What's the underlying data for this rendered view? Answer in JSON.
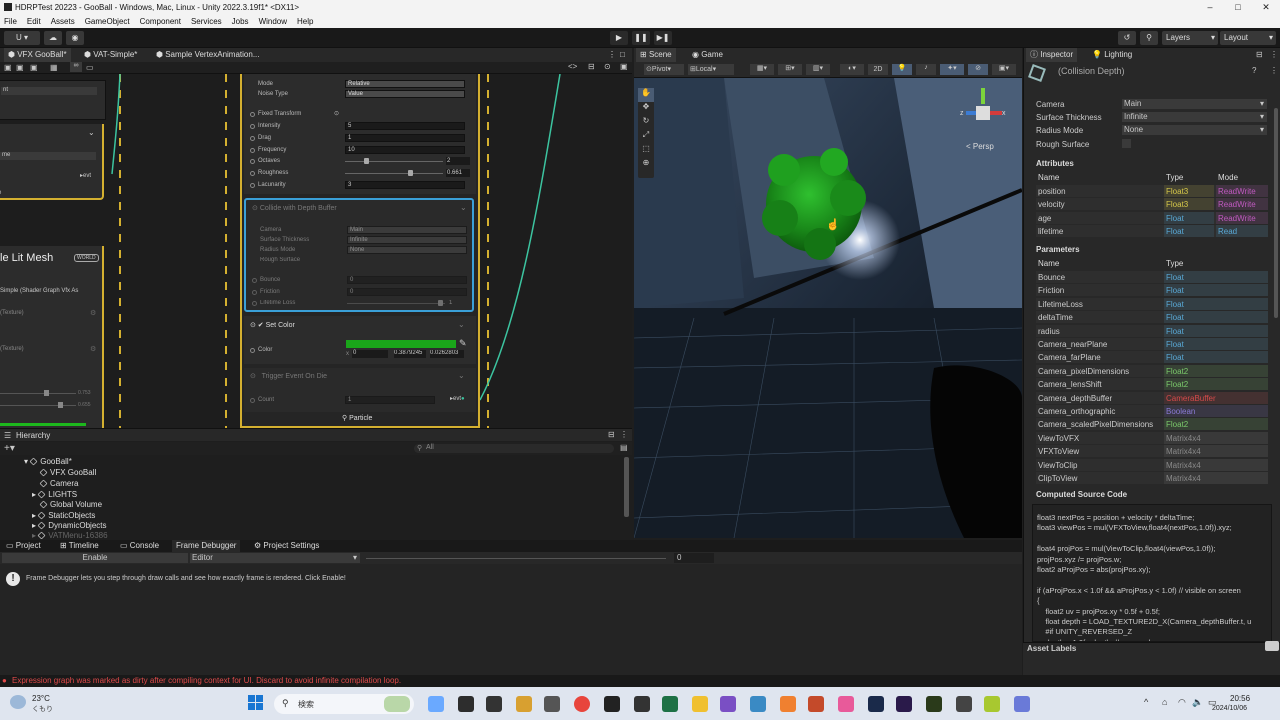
{
  "window": {
    "title": "HDRPTest 20223 - GooBall - Windows, Mac, Linux - Unity 2022.3.19f1* <DX11>"
  },
  "menu": [
    "File",
    "Edit",
    "Assets",
    "GameObject",
    "Component",
    "Services",
    "Jobs",
    "Window",
    "Help"
  ],
  "toolbar": {
    "account": "U",
    "layers": "Layers",
    "layout": "Layout"
  },
  "vfx": {
    "tabs": [
      "VFX GooBall*",
      "VAT-Simple*",
      "Sample VertexAnimation..."
    ],
    "left_node_title": "le Lit Mesh",
    "left_node_badge": "WORLD",
    "left_node_sub": "Simple (Shader Graph Vfx As",
    "left_texture1": "(Texture)",
    "left_texture2": "(Texture)",
    "left_evt": "evt",
    "left_val1": "0.753",
    "left_val2": "0.655",
    "left_sel": "nt",
    "left_sel2": "me",
    "left_e": "e",
    "noise": {
      "mode_label": "Mode",
      "mode_value": "Relative",
      "noise_type_label": "Noise Type",
      "noise_type_value": "Value",
      "fixed_transform": "Fixed Transform",
      "intensity_label": "Intensity",
      "intensity_value": "5",
      "drag_label": "Drag",
      "drag_value": "1",
      "frequency_label": "Frequency",
      "frequency_value": "10",
      "octaves_label": "Octaves",
      "octaves_value": "2",
      "roughness_label": "Roughness",
      "roughness_value": "0.661",
      "lacunarity_label": "Lacunarity",
      "lacunarity_value": "3"
    },
    "collide": {
      "title": "Collide with Depth Buffer",
      "camera_label": "Camera",
      "camera_value": "Main",
      "surface_label": "Surface Thickness",
      "surface_value": "Infinite",
      "radius_label": "Radius Mode",
      "radius_value": "None",
      "rough_label": "Rough Surface",
      "bounce_label": "Bounce",
      "bounce_value": "0",
      "friction_label": "Friction",
      "friction_value": "0",
      "lifetime_label": "Lifetime Loss",
      "lifetime_value": "1"
    },
    "setcolor": {
      "title": "Set Color",
      "color_label": "Color",
      "x_label": "x",
      "x_value": "0",
      "y_value": "0.3879245",
      "z_value": "0.0262803",
      "color": "#1aa61a"
    },
    "trigger": {
      "title": "Trigger Event On Die",
      "count_label": "Count",
      "count_value": "1",
      "evt": "evt",
      "particle": "Particle"
    }
  },
  "hierarchy": {
    "title": "Hierarchy",
    "search_placeholder": "All",
    "items": [
      "GooBall*",
      "VFX GooBall",
      "Camera",
      "LIGHTS",
      "Global Volume",
      "StaticObjects",
      "DynamicObjects",
      "VATMenu-16386"
    ]
  },
  "bottom_tabs": [
    "Project",
    "Timeline",
    "Console",
    "Frame Debugger",
    "Project Settings"
  ],
  "frame_debugger": {
    "enable": "Enable",
    "editor": "Editor",
    "slider_value": "0",
    "info": "Frame Debugger lets you step through draw calls and see how exactly frame is rendered. Click Enable!"
  },
  "scene": {
    "tabs": [
      "Scene",
      "Game"
    ],
    "pivot": "Pivot",
    "local": "Local",
    "mode2d": "2D",
    "persp": "< Persp",
    "axis_z": "z",
    "axis_x": "x"
  },
  "inspector": {
    "tabs": [
      "Inspector",
      "Lighting"
    ],
    "header": "(Collision Depth)",
    "camera_label": "Camera",
    "camera_value": "Main",
    "surface_label": "Surface Thickness",
    "surface_value": "Infinite",
    "radius_label": "Radius Mode",
    "radius_value": "None",
    "rough_label": "Rough Surface",
    "attributes_title": "Attributes",
    "attr_headers": [
      "Name",
      "Type",
      "Mode"
    ],
    "attributes": [
      {
        "name": "position",
        "type": "Float3",
        "mode": "ReadWrite"
      },
      {
        "name": "velocity",
        "type": "Float3",
        "mode": "ReadWrite"
      },
      {
        "name": "age",
        "type": "Float",
        "mode": "ReadWrite"
      },
      {
        "name": "lifetime",
        "type": "Float",
        "mode": "Read"
      }
    ],
    "parameters_title": "Parameters",
    "param_headers": [
      "Name",
      "Type"
    ],
    "parameters": [
      {
        "name": "Bounce",
        "type": "Float"
      },
      {
        "name": "Friction",
        "type": "Float"
      },
      {
        "name": "LifetimeLoss",
        "type": "Float"
      },
      {
        "name": "deltaTime",
        "type": "Float"
      },
      {
        "name": "radius",
        "type": "Float"
      },
      {
        "name": "Camera_nearPlane",
        "type": "Float"
      },
      {
        "name": "Camera_farPlane",
        "type": "Float"
      },
      {
        "name": "Camera_pixelDimensions",
        "type": "Float2"
      },
      {
        "name": "Camera_lensShift",
        "type": "Float2"
      },
      {
        "name": "Camera_depthBuffer",
        "type": "CameraBuffer"
      },
      {
        "name": "Camera_orthographic",
        "type": "Boolean"
      },
      {
        "name": "Camera_scaledPixelDimensions",
        "type": "Float2"
      },
      {
        "name": "ViewToVFX",
        "type": "Matrix4x4"
      },
      {
        "name": "VFXToView",
        "type": "Matrix4x4"
      },
      {
        "name": "ViewToClip",
        "type": "Matrix4x4"
      },
      {
        "name": "ClipToView",
        "type": "Matrix4x4"
      }
    ],
    "code_title": "Computed Source Code",
    "code": [
      "float3 nextPos = position + velocity * deltaTime;",
      "float3 viewPos = mul(VFXToView,float4(nextPos,1.0f)).xyz;",
      "",
      "float4 projPos = mul(ViewToClip,float4(viewPos,1.0f));",
      "projPos.xyz /= projPos.w;",
      "float2 aProjPos = abs(projPos.xy);",
      "",
      "if (aProjPos.x < 1.0f && aProjPos.y < 1.0f) // visible on screen",
      "{",
      "    float2 uv = projPos.xy * 0.5f + 0.5f;",
      "    float depth = LOAD_TEXTURE2D_X(Camera_depthBuffer.t, u",
      "    #if UNITY_REVERSED_Z",
      "    depth = 1.0f - depth; // reversed z"
    ],
    "asset_labels": "Asset Labels"
  },
  "status": {
    "message": "Expression graph was marked as dirty after compiling context for UI. Discard to avoid infinite compilation loop."
  },
  "taskbar": {
    "temp": "23°C",
    "weather": "くもり",
    "search": "検索",
    "time": "20:56",
    "date": "2024/10/06"
  },
  "colors": {
    "float": "#5aa9d6",
    "float2": "#7bc96b",
    "float3": "#d6c84a",
    "readwrite": "#c05ac0",
    "read": "#5aa9d6",
    "camerabuffer": "#d64a4a",
    "boolean": "#8a7ad6",
    "matrix": "#8a8a8a",
    "green_goo": "#1d8a1d"
  }
}
